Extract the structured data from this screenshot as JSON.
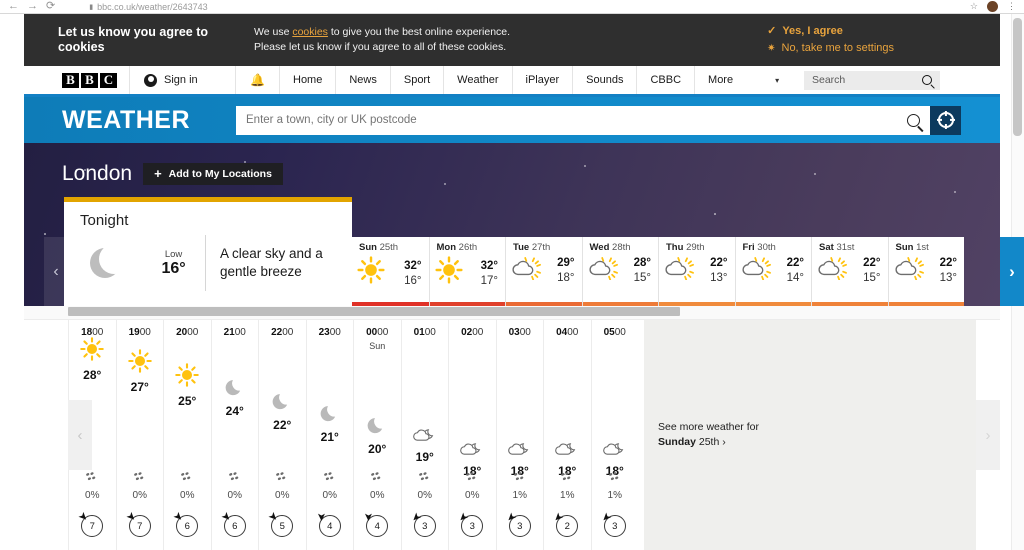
{
  "browser": {
    "url": "bbc.co.uk/weather/2643743",
    "back_icon": "back-arrow-icon",
    "forward_icon": "forward-arrow-icon",
    "reload_icon": "reload-icon",
    "lock_icon": "padlock-icon",
    "bookmark_icon": "star-icon",
    "menu_icon": "kebab-menu-icon"
  },
  "cookie_banner": {
    "title": "Let us know you agree to cookies",
    "body_line1_pre": "We use ",
    "body_link": "cookies",
    "body_line1_post": " to give you the best online experience.",
    "body_line2": "Please let us know if you agree to all of these cookies.",
    "agree_label": "Yes, I agree",
    "settings_label": "No, take me to settings",
    "accent_color": "#e8a33d",
    "background_color": "#2f2f2f"
  },
  "bbc_nav": {
    "logo_letters": [
      "B",
      "B",
      "C"
    ],
    "sign_in": "Sign in",
    "bell_icon": "notification-bell-icon",
    "items": [
      "Home",
      "News",
      "Sport",
      "Weather",
      "iPlayer",
      "Sounds",
      "CBBC",
      "More"
    ],
    "more_caret": "▾",
    "search_placeholder": "Search",
    "accent_color": "#1380c4"
  },
  "weather_header": {
    "brand": "WEATHER",
    "search_placeholder": "Enter a town, city or UK postcode",
    "search_value": "",
    "search_icon": "magnifier-icon",
    "geolocate_icon": "crosshair-icon",
    "band_color": "#1189c9"
  },
  "location": {
    "name": "London",
    "add_label": "Add to My Locations",
    "add_icon": "plus-icon"
  },
  "tonight": {
    "title": "Tonight",
    "icon": "moon-icon",
    "low_label": "Low",
    "low_value": "16°",
    "description": "A clear sky and a gentle breeze",
    "accent_color": "#e2a400"
  },
  "day_forecast": {
    "prev_label": "‹",
    "next_label": "›",
    "days": [
      {
        "weekday": "Sun",
        "date": "25th",
        "icon": "sun-icon",
        "high": "32°",
        "low": "16°",
        "bar_color": "#e03127"
      },
      {
        "weekday": "Mon",
        "date": "26th",
        "icon": "sun-icon",
        "high": "32°",
        "low": "17°",
        "bar_color": "#e0402b"
      },
      {
        "weekday": "Tue",
        "date": "27th",
        "icon": "sun-cloud-icon",
        "high": "29°",
        "low": "18°",
        "bar_color": "#ea6a34"
      },
      {
        "weekday": "Wed",
        "date": "28th",
        "icon": "sun-cloud-icon",
        "high": "28°",
        "low": "15°",
        "bar_color": "#ee7b38"
      },
      {
        "weekday": "Thu",
        "date": "29th",
        "icon": "sun-cloud-icon",
        "high": "22°",
        "low": "13°",
        "bar_color": "#f08b3c"
      },
      {
        "weekday": "Fri",
        "date": "30th",
        "icon": "sun-cloud-icon",
        "high": "22°",
        "low": "14°",
        "bar_color": "#f08b3c"
      },
      {
        "weekday": "Sat",
        "date": "31st",
        "icon": "sun-cloud-icon",
        "high": "22°",
        "low": "15°",
        "bar_color": "#ef8239"
      },
      {
        "weekday": "Sun",
        "date": "1st",
        "icon": "sun-cloud-icon",
        "high": "22°",
        "low": "13°",
        "bar_color": "#ef8239"
      }
    ]
  },
  "hourly_forecast": {
    "prev_label": "‹",
    "next_label": "›",
    "precip_icon": "raindrops-icon",
    "hours": [
      {
        "time_bold": "18",
        "time_rest": "00",
        "day_label": "",
        "icon": "sun-icon",
        "temp": "28°",
        "precip": "0%",
        "wind_speed": "7",
        "wind_dir": "ne"
      },
      {
        "time_bold": "19",
        "time_rest": "00",
        "day_label": "",
        "icon": "sun-icon",
        "temp": "27°",
        "precip": "0%",
        "wind_speed": "7",
        "wind_dir": "ne"
      },
      {
        "time_bold": "20",
        "time_rest": "00",
        "day_label": "",
        "icon": "sun-icon",
        "temp": "25°",
        "precip": "0%",
        "wind_speed": "6",
        "wind_dir": "ne"
      },
      {
        "time_bold": "21",
        "time_rest": "00",
        "day_label": "",
        "icon": "moon-icon",
        "temp": "24°",
        "precip": "0%",
        "wind_speed": "6",
        "wind_dir": "ne"
      },
      {
        "time_bold": "22",
        "time_rest": "00",
        "day_label": "",
        "icon": "moon-icon",
        "temp": "22°",
        "precip": "0%",
        "wind_speed": "5",
        "wind_dir": "ne"
      },
      {
        "time_bold": "23",
        "time_rest": "00",
        "day_label": "",
        "icon": "moon-icon",
        "temp": "21°",
        "precip": "0%",
        "wind_speed": "4",
        "wind_dir": "e"
      },
      {
        "time_bold": "00",
        "time_rest": "00",
        "day_label": "Sun",
        "icon": "moon-icon",
        "temp": "20°",
        "precip": "0%",
        "wind_speed": "4",
        "wind_dir": "e"
      },
      {
        "time_bold": "01",
        "time_rest": "00",
        "day_label": "",
        "icon": "moon-cloud-icon",
        "temp": "19°",
        "precip": "0%",
        "wind_speed": "3",
        "wind_dir": "se"
      },
      {
        "time_bold": "02",
        "time_rest": "00",
        "day_label": "",
        "icon": "moon-cloud-icon",
        "temp": "18°",
        "precip": "0%",
        "wind_speed": "3",
        "wind_dir": "se"
      },
      {
        "time_bold": "03",
        "time_rest": "00",
        "day_label": "",
        "icon": "moon-cloud-icon",
        "temp": "18°",
        "precip": "1%",
        "wind_speed": "3",
        "wind_dir": "se"
      },
      {
        "time_bold": "04",
        "time_rest": "00",
        "day_label": "",
        "icon": "moon-cloud-icon",
        "temp": "18°",
        "precip": "1%",
        "wind_speed": "2",
        "wind_dir": "se"
      },
      {
        "time_bold": "05",
        "time_rest": "00",
        "day_label": "",
        "icon": "moon-cloud-icon",
        "temp": "18°",
        "precip": "1%",
        "wind_speed": "3",
        "wind_dir": "se"
      }
    ]
  },
  "see_more": {
    "line1": "See more weather for",
    "day_bold": "Sunday",
    "day_rest": " 25th",
    "chevron": "›"
  }
}
